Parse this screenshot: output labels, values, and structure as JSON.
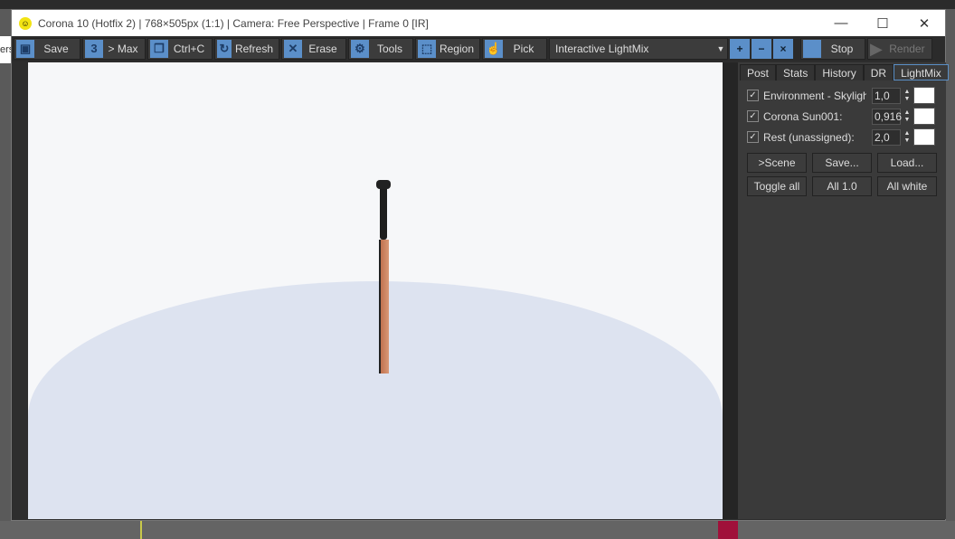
{
  "window": {
    "title": "Corona 10 (Hotfix 2) | 768×505px (1:1) | Camera: Free Perspective | Frame 0 [IR]",
    "minimize": "—",
    "maximize": "☐",
    "close": "✕"
  },
  "side_fragment": "ers",
  "toolbar": {
    "buttons": [
      {
        "icon": "save-icon",
        "glyph": "▣",
        "label": "Save"
      },
      {
        "icon": "max-icon",
        "glyph": "3",
        "label": "> Max"
      },
      {
        "icon": "copy-icon",
        "glyph": "❐",
        "label": "Ctrl+C"
      },
      {
        "icon": "refresh-icon",
        "glyph": "↻",
        "label": "Refresh"
      },
      {
        "icon": "erase-icon",
        "glyph": "✕",
        "label": "Erase"
      },
      {
        "icon": "gear-icon",
        "glyph": "⚙",
        "label": "Tools"
      },
      {
        "icon": "region-icon",
        "glyph": "⬚",
        "label": "Region"
      },
      {
        "icon": "pick-icon",
        "glyph": "☝",
        "label": "Pick"
      }
    ],
    "display_select": "Interactive LightMix",
    "stop": "Stop",
    "render": "Render"
  },
  "panel": {
    "tabs": [
      "Post",
      "Stats",
      "History",
      "DR",
      "LightMix"
    ],
    "active_tab": "LightMix",
    "lights": [
      {
        "name": "Environment - Skylight",
        "value": "1,0",
        "checked": true,
        "color": "#ffffff"
      },
      {
        "name": "Corona Sun001:",
        "value": "0,916",
        "checked": true,
        "color": "#ffffff"
      },
      {
        "name": "Rest (unassigned):",
        "value": "2,0",
        "checked": true,
        "color": "#ffffff"
      }
    ],
    "buttons_row1": [
      ">Scene",
      "Save...",
      "Load..."
    ],
    "buttons_row2": [
      "Toggle all",
      "All 1.0",
      "All white"
    ]
  }
}
